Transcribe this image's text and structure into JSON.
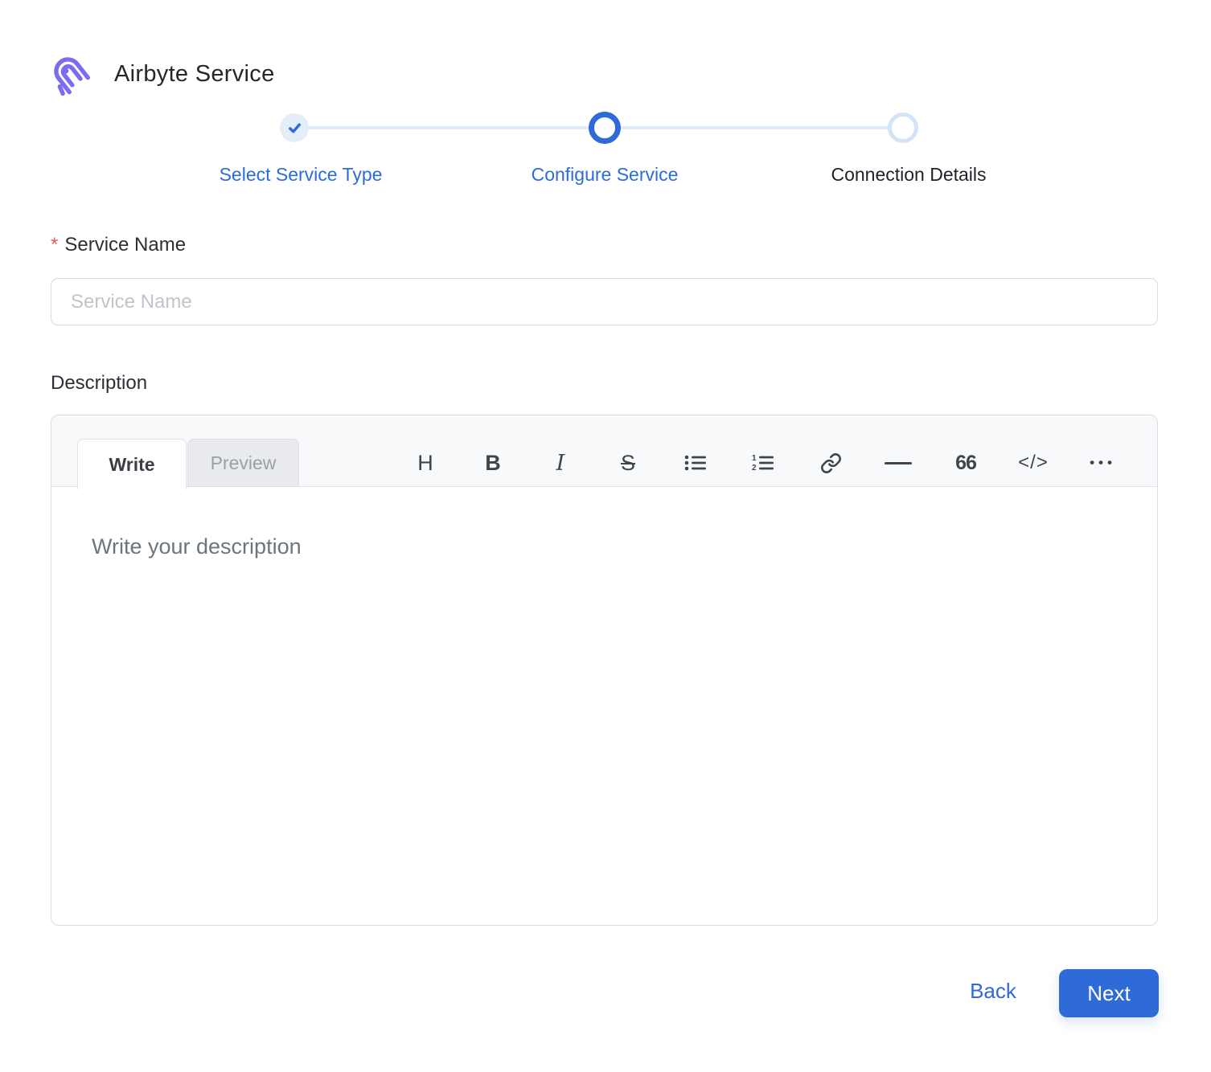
{
  "header": {
    "title": "Airbyte Service",
    "logo_icon": "airbyte-octopus-logo"
  },
  "stepper": {
    "steps": [
      {
        "label": "Select Service Type",
        "state": "completed",
        "icon": "check-icon"
      },
      {
        "label": "Configure Service",
        "state": "active"
      },
      {
        "label": "Connection Details",
        "state": "upcoming"
      }
    ]
  },
  "form": {
    "service_name": {
      "required_marker": "*",
      "label": "Service Name",
      "placeholder": "Service Name",
      "value": ""
    },
    "description": {
      "label": "Description",
      "editor": {
        "tabs": [
          {
            "label": "Write",
            "active": true
          },
          {
            "label": "Preview",
            "active": false
          }
        ],
        "toolbar": [
          {
            "name": "heading",
            "glyph": "H"
          },
          {
            "name": "bold",
            "glyph": "B"
          },
          {
            "name": "italic",
            "glyph": "I"
          },
          {
            "name": "strikethrough",
            "glyph": "S"
          },
          {
            "name": "bullet-list"
          },
          {
            "name": "numbered-list"
          },
          {
            "name": "link"
          },
          {
            "name": "horizontal-rule"
          },
          {
            "name": "quote",
            "glyph": "66"
          },
          {
            "name": "code",
            "glyph": "</>"
          },
          {
            "name": "more",
            "glyph": "•••"
          }
        ],
        "placeholder": "Write your description",
        "value": ""
      }
    }
  },
  "footer": {
    "back_label": "Back",
    "next_label": "Next"
  },
  "colors": {
    "accent_blue": "#2f6bd8",
    "stepper_line": "#e0ebf9",
    "completed_circle_bg": "#e4eefb",
    "upcoming_circle_border": "#d3e3f8",
    "logo_purple": "#7c6cf2",
    "required_red": "#e85c50",
    "editor_header_bg": "#f8f9fb",
    "border_gray": "#d9dce2",
    "placeholder_gray": "#c2c4ca",
    "editor_placeholder": "#6b7480"
  }
}
